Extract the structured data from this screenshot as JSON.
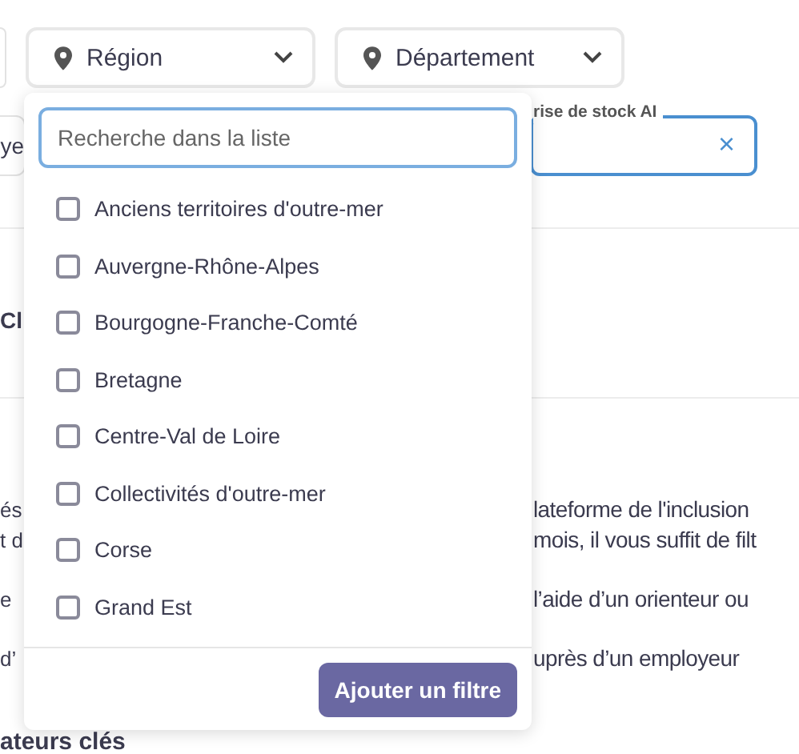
{
  "filter_buttons": [
    {
      "label": "Région"
    },
    {
      "label": "Département"
    }
  ],
  "left_field": {
    "value": "ye"
  },
  "stock_field": {
    "label": "rise de stock AI",
    "clear": "×"
  },
  "section_heading": "Cl",
  "paragraphs": [
    {
      "lines": [
        {
          "left": "és",
          "right": "lateforme de l'inclusion"
        },
        {
          "left": "t d",
          "right": "mois, il vous suffit de filt"
        }
      ]
    },
    {
      "lines": [
        {
          "left": "e",
          "right": "l’aide d’un orienteur ou"
        }
      ]
    },
    {
      "lines": [
        {
          "left": "d’",
          "right": "uprès d’un employeur"
        }
      ]
    }
  ],
  "bottom_heading": "ateurs clés",
  "dropdown": {
    "search": {
      "placeholder": "Recherche dans la liste"
    },
    "options": [
      {
        "label": "Anciens territoires d'outre-mer",
        "checked": false
      },
      {
        "label": "Auvergne-Rhône-Alpes",
        "checked": false
      },
      {
        "label": "Bourgogne-Franche-Comté",
        "checked": false
      },
      {
        "label": "Bretagne",
        "checked": false
      },
      {
        "label": "Centre-Val de Loire",
        "checked": false
      },
      {
        "label": "Collectivités d'outre-mer",
        "checked": false
      },
      {
        "label": "Corse",
        "checked": false
      },
      {
        "label": "Grand Est",
        "checked": false
      }
    ],
    "button": "Ajouter un filtre"
  }
}
